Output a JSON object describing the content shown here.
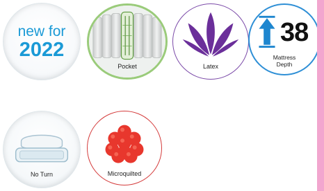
{
  "badges": {
    "new": {
      "line1": "new for",
      "line2": "2022",
      "icon": "new-for-2022-badge"
    },
    "pocket": {
      "label": "Pocket",
      "icon": "pocket-spring-icon"
    },
    "latex": {
      "label": "Latex",
      "icon": "latex-leaf-icon"
    },
    "depth": {
      "number": "38",
      "line1": "Mattress",
      "line2": "Depth",
      "icon": "mattress-depth-arrow-icon"
    },
    "noturn": {
      "label": "No Turn",
      "icon": "no-turn-mattress-icon"
    },
    "micro": {
      "label": "Microquilted",
      "icon": "microquilted-flower-icon"
    }
  },
  "colors": {
    "new_text": "#1b9ad6",
    "pocket_ring": "#9acb7a",
    "latex_ring": "#7b4aa8",
    "depth_ring": "#2e8fd6",
    "micro_ring": "#d43b3b",
    "side_strip": "#f2a6cf"
  }
}
